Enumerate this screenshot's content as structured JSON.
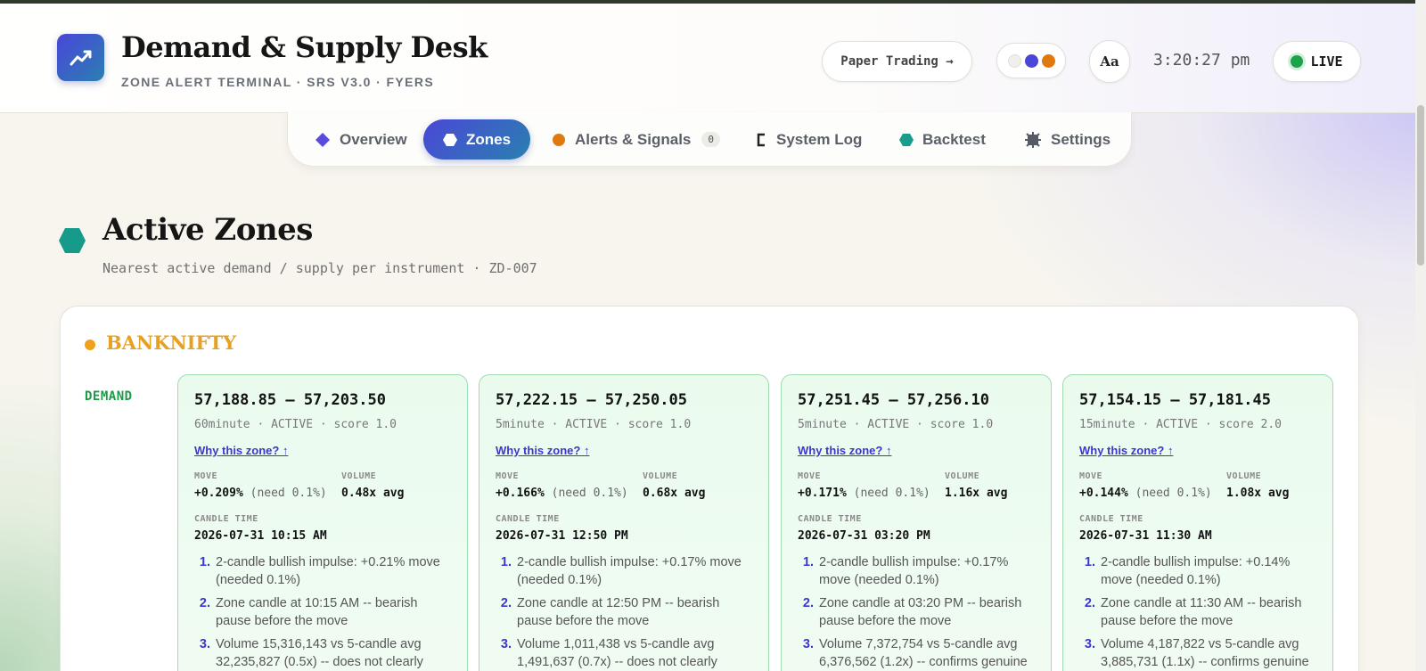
{
  "header": {
    "title": "Demand & Supply Desk",
    "subtitle": "ZONE ALERT TERMINAL · SRS V3.0 · FYERS",
    "paper_trading_label": "Paper Trading →",
    "theme_colors": [
      "#f0efe9",
      "#4a46d8",
      "#e07a10"
    ],
    "font_toggle_label": "Aa",
    "clock": "3:20:27 pm",
    "live_label": "LIVE"
  },
  "nav": {
    "tabs": [
      {
        "label": "Overview",
        "icon": "diamond-icon",
        "color": "#5a4be0"
      },
      {
        "label": "Zones",
        "icon": "hexagon-icon",
        "color": "#ffffff"
      },
      {
        "label": "Alerts & Signals",
        "icon": "circle-icon",
        "color": "#e07a10",
        "badge": "0"
      },
      {
        "label": "System Log",
        "icon": "c-bracket-icon",
        "color": "#222222"
      },
      {
        "label": "Backtest",
        "icon": "hexagon-icon",
        "color": "#189e8a"
      },
      {
        "label": "Settings",
        "icon": "gear-icon",
        "color": "#555a66"
      }
    ],
    "active_tab": "Zones"
  },
  "section": {
    "title": "Active Zones",
    "subtitle": "Nearest active demand / supply per instrument · ZD-007",
    "icon_color": "#169a8a"
  },
  "instrument": {
    "name": "BANKNIFTY",
    "demand_label": "DEMAND",
    "zones": [
      {
        "range": "57,188.85 – 57,203.50",
        "meta": "60minute · ACTIVE · score 1.0",
        "why": "Why this zone? ↑",
        "move_label": "MOVE",
        "move_value": "+0.209%",
        "move_need": "(need 0.1%)",
        "volume_label": "VOLUME",
        "volume_value": "0.48x avg",
        "candle_label": "CANDLE TIME",
        "candle_time": "2026-07-31 10:15 AM",
        "reasons": [
          "2-candle bullish impulse: +0.21% move (needed 0.1%)",
          "Zone candle at 10:15 AM -- bearish pause before the move",
          "Volume 15,316,143 vs 5-candle avg 32,235,827 (0.5x) -- does not clearly"
        ]
      },
      {
        "range": "57,222.15 – 57,250.05",
        "meta": "5minute · ACTIVE · score 1.0",
        "why": "Why this zone? ↑",
        "move_label": "MOVE",
        "move_value": "+0.166%",
        "move_need": "(need 0.1%)",
        "volume_label": "VOLUME",
        "volume_value": "0.68x avg",
        "candle_label": "CANDLE TIME",
        "candle_time": "2026-07-31 12:50 PM",
        "reasons": [
          "2-candle bullish impulse: +0.17% move (needed 0.1%)",
          "Zone candle at 12:50 PM -- bearish pause before the move",
          "Volume 1,011,438 vs 5-candle avg 1,491,637 (0.7x) -- does not clearly"
        ]
      },
      {
        "range": "57,251.45 – 57,256.10",
        "meta": "5minute · ACTIVE · score 1.0",
        "why": "Why this zone? ↑",
        "move_label": "MOVE",
        "move_value": "+0.171%",
        "move_need": "(need 0.1%)",
        "volume_label": "VOLUME",
        "volume_value": "1.16x avg",
        "candle_label": "CANDLE TIME",
        "candle_time": "2026-07-31 03:20 PM",
        "reasons": [
          "2-candle bullish impulse: +0.17% move (needed 0.1%)",
          "Zone candle at 03:20 PM -- bearish pause before the move",
          "Volume 7,372,754 vs 5-candle avg 6,376,562 (1.2x) -- confirms genuine"
        ]
      },
      {
        "range": "57,154.15 – 57,181.45",
        "meta": "15minute · ACTIVE · score 2.0",
        "why": "Why this zone? ↑",
        "move_label": "MOVE",
        "move_value": "+0.144%",
        "move_need": "(need 0.1%)",
        "volume_label": "VOLUME",
        "volume_value": "1.08x avg",
        "candle_label": "CANDLE TIME",
        "candle_time": "2026-07-31 11:30 AM",
        "reasons": [
          "2-candle bullish impulse: +0.14% move (needed 0.1%)",
          "Zone candle at 11:30 AM -- bearish pause before the move",
          "Volume 4,187,822 vs 5-candle avg 3,885,731 (1.1x) -- confirms genuine"
        ]
      }
    ]
  }
}
